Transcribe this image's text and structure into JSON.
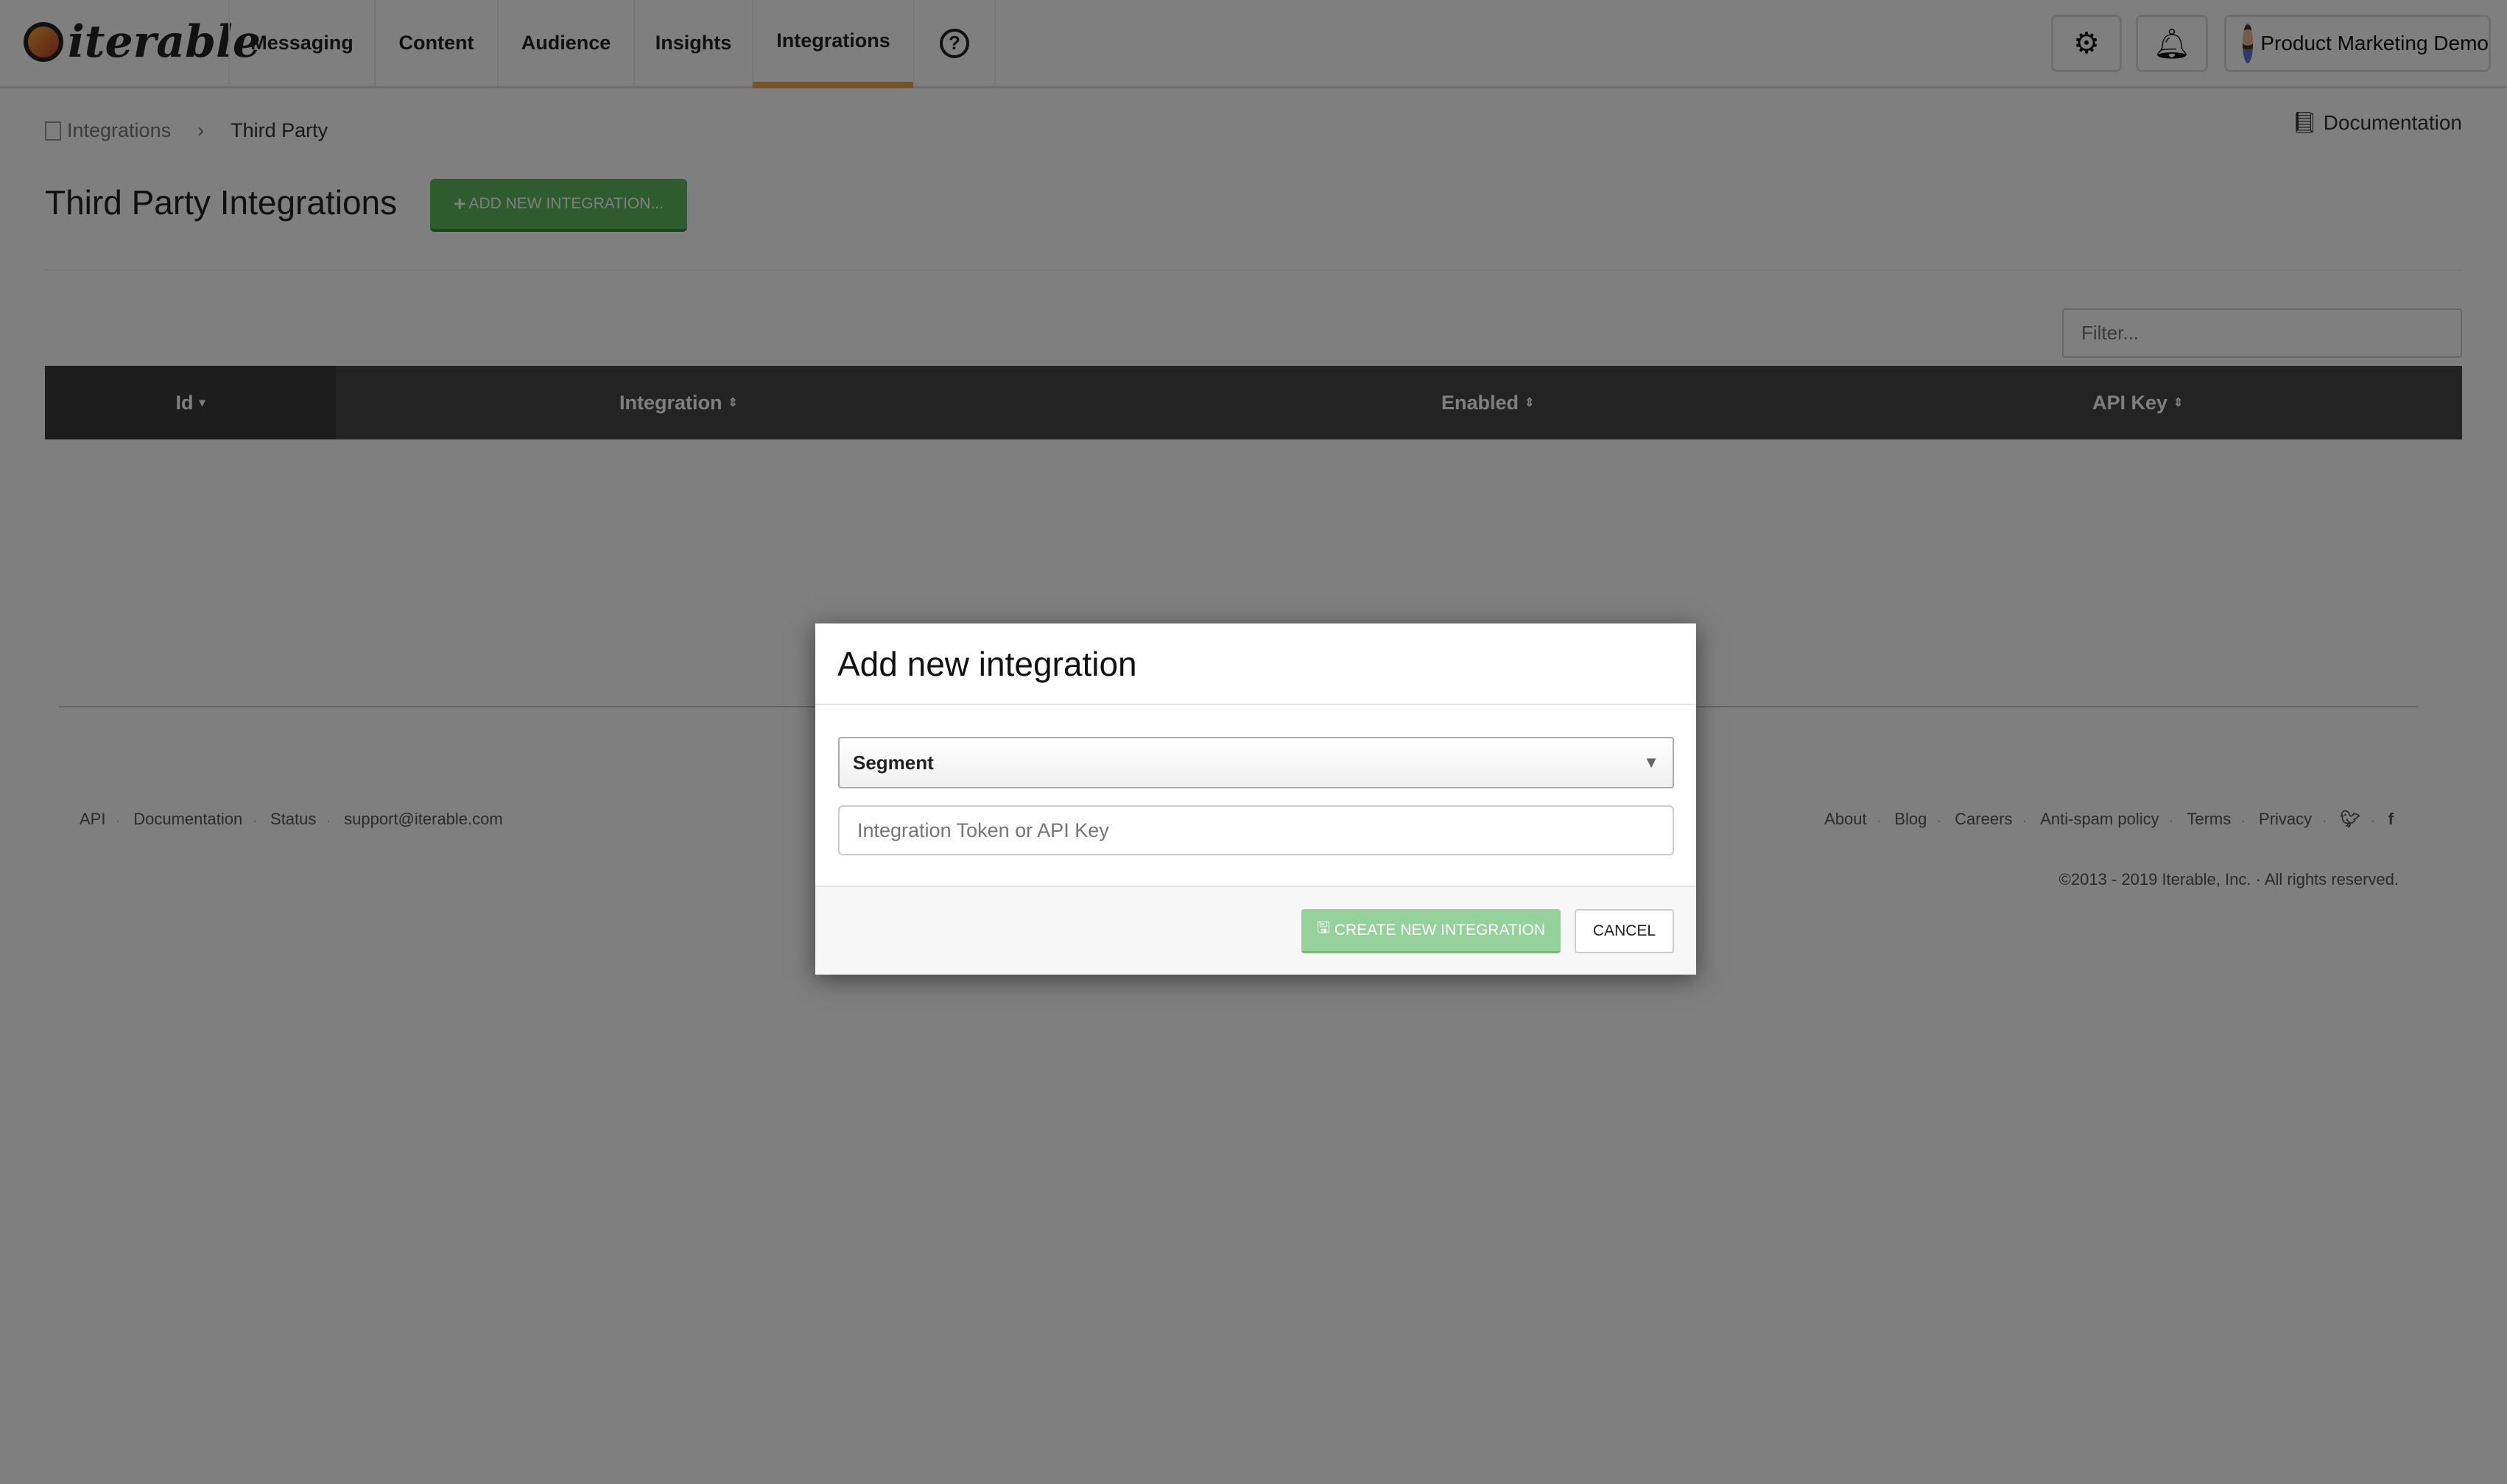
{
  "nav": {
    "logo": "iterable",
    "items": [
      {
        "label": "Messaging"
      },
      {
        "label": "Content"
      },
      {
        "label": "Audience"
      },
      {
        "label": "Insights"
      },
      {
        "label": "Integrations",
        "active": true
      }
    ],
    "help_icon": "question-circle-icon",
    "settings_icon": "gear-icon",
    "notifications_icon": "bell-icon",
    "user_name": "Product Marketing Demo",
    "accent": "#f2a640"
  },
  "breadcrumb": {
    "items": [
      "Integrations",
      "Third Party"
    ]
  },
  "documentation_link": "Documentation",
  "page": {
    "title": "Third Party Integrations",
    "add_button": "ADD NEW INTEGRATION..."
  },
  "filter": {
    "placeholder": "Filter..."
  },
  "table": {
    "columns": [
      "Id",
      "Integration",
      "Enabled",
      "API Key"
    ],
    "rows": []
  },
  "footer": {
    "left_links": [
      "API",
      "Documentation",
      "Status",
      "support@iterable.com"
    ],
    "right_links": [
      "About",
      "Blog",
      "Careers",
      "Anti-spam policy",
      "Terms",
      "Privacy"
    ],
    "social": [
      "twitter-icon",
      "facebook-icon"
    ],
    "copyright": "©2013 - 2019 Iterable, Inc. · All rights reserved."
  },
  "modal": {
    "title": "Add new integration",
    "select_value": "Segment",
    "token_placeholder": "Integration Token or API Key",
    "create_button": "CREATE NEW INTEGRATION",
    "cancel_button": "CANCEL"
  }
}
